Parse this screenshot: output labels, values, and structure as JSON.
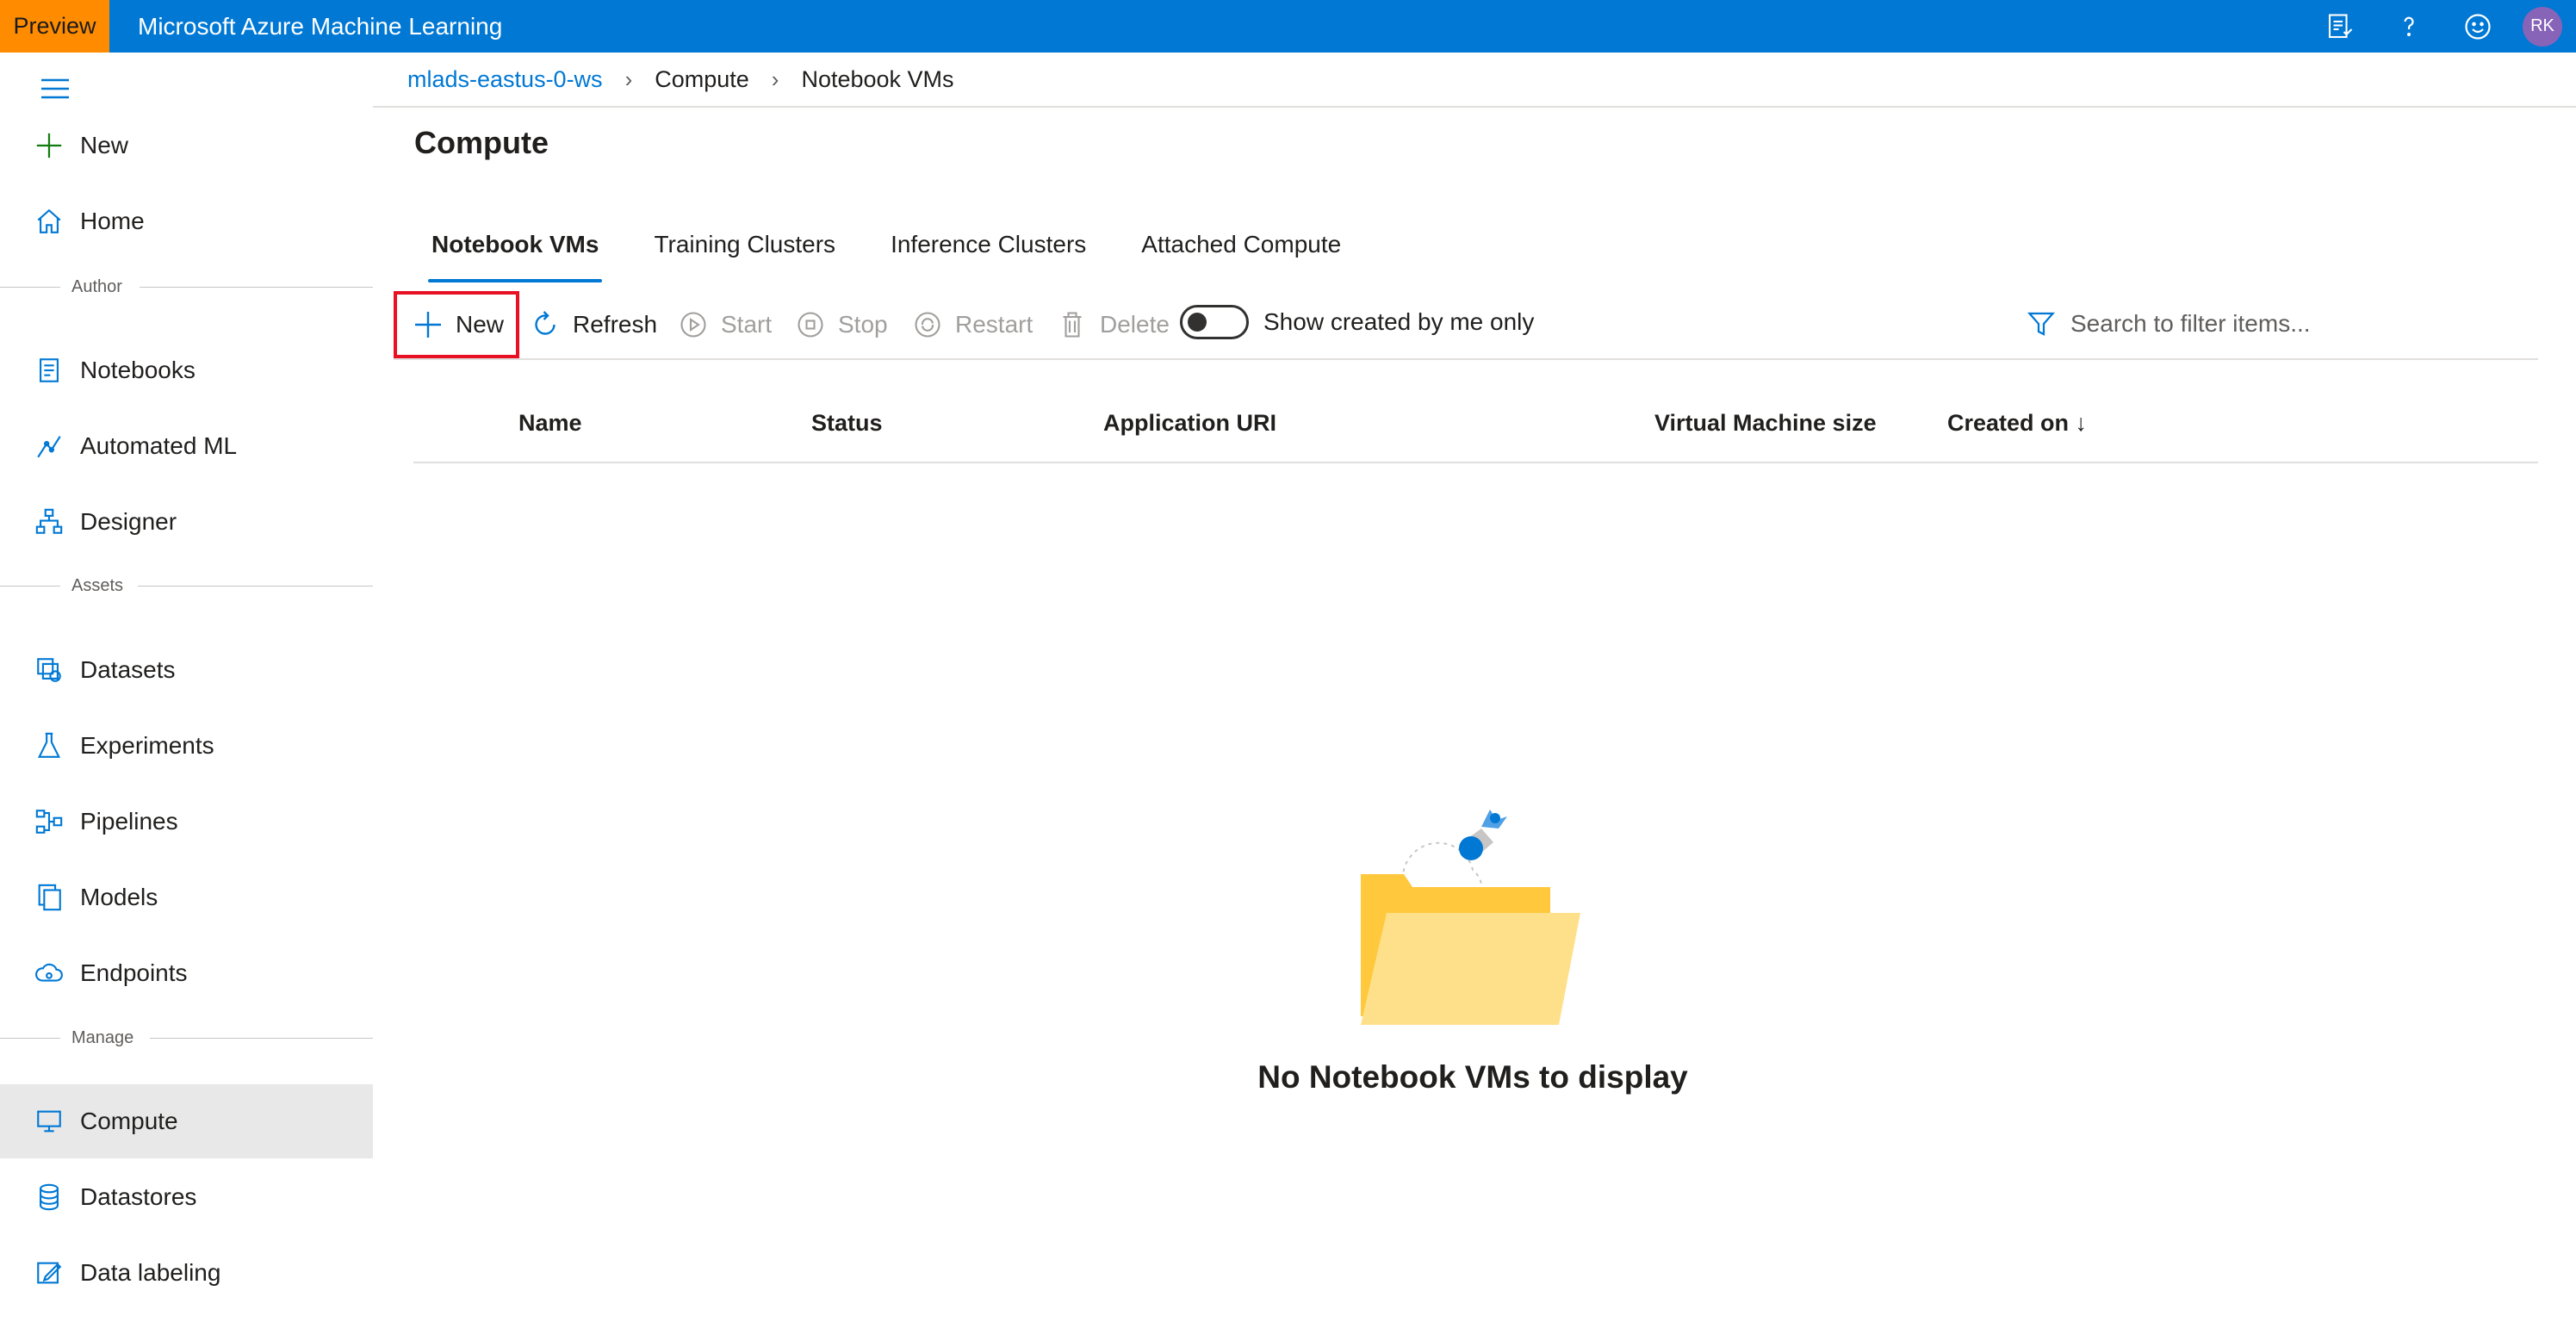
{
  "topbar": {
    "preview_label": "Preview",
    "app_title": "Microsoft Azure Machine Learning",
    "avatar_initials": "RK",
    "icons": [
      "feedback-list-icon",
      "help-icon",
      "smiley-icon"
    ],
    "bar_color": "#0078d4",
    "preview_color": "#ff8c00"
  },
  "sidebar": {
    "new_label": "New",
    "home_label": "Home",
    "sections": {
      "author": "Author",
      "assets": "Assets",
      "manage": "Manage"
    },
    "items": [
      {
        "label": "Notebooks",
        "icon": "notebook-icon"
      },
      {
        "label": "Automated ML",
        "icon": "automated-ml-icon"
      },
      {
        "label": "Designer",
        "icon": "designer-icon"
      },
      {
        "label": "Datasets",
        "icon": "datasets-icon"
      },
      {
        "label": "Experiments",
        "icon": "flask-icon"
      },
      {
        "label": "Pipelines",
        "icon": "pipelines-icon"
      },
      {
        "label": "Models",
        "icon": "models-icon"
      },
      {
        "label": "Endpoints",
        "icon": "endpoints-icon"
      },
      {
        "label": "Compute",
        "icon": "compute-icon",
        "active": true
      },
      {
        "label": "Datastores",
        "icon": "datastore-icon"
      },
      {
        "label": "Data labeling",
        "icon": "data-labeling-icon"
      }
    ]
  },
  "breadcrumb": {
    "workspace": "mlads-eastus-0-ws",
    "section": "Compute",
    "current": "Notebook VMs"
  },
  "page": {
    "title": "Compute"
  },
  "tabs": [
    "Notebook VMs",
    "Training Clusters",
    "Inference Clusters",
    "Attached Compute"
  ],
  "toolbar": {
    "new_label": "New",
    "refresh_label": "Refresh",
    "start_label": "Start",
    "stop_label": "Stop",
    "restart_label": "Restart",
    "delete_label": "Delete",
    "toggle_label": "Show created by me only",
    "toggle_on": false,
    "search_placeholder": "Search to filter items..."
  },
  "table": {
    "columns": [
      "Name",
      "Status",
      "Application URI",
      "Virtual Machine size",
      "Created on ↓"
    ],
    "rows": []
  },
  "empty_state": {
    "message": "No Notebook VMs to display"
  }
}
